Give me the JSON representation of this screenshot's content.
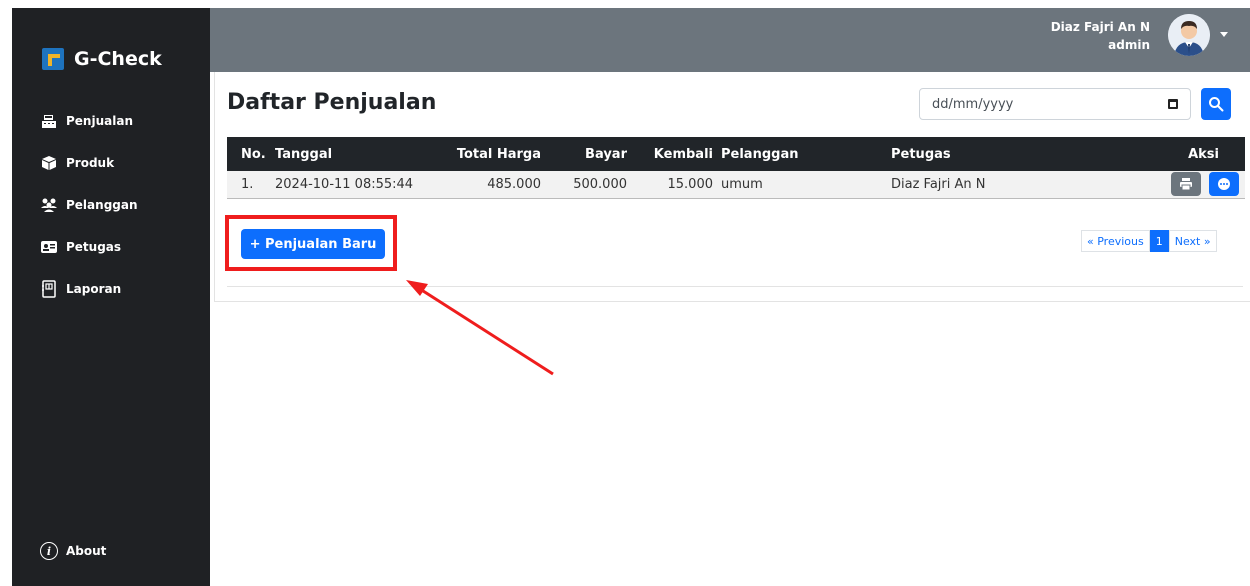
{
  "brand": {
    "name": "G-Check"
  },
  "sidebar": {
    "items": [
      {
        "label": "Penjualan",
        "icon": "cash-register-icon"
      },
      {
        "label": "Produk",
        "icon": "box-icon"
      },
      {
        "label": "Pelanggan",
        "icon": "users-icon"
      },
      {
        "label": "Petugas",
        "icon": "id-card-icon"
      },
      {
        "label": "Laporan",
        "icon": "book-icon"
      }
    ],
    "about_label": "About"
  },
  "topbar": {
    "user_name": "Diaz Fajri An N",
    "user_role": "admin"
  },
  "page": {
    "title": "Daftar Penjualan",
    "date_placeholder": "dd/mm/yyyy"
  },
  "table": {
    "headers": [
      "No.",
      "Tanggal",
      "Total Harga",
      "Bayar",
      "Kembali",
      "Pelanggan",
      "Petugas",
      "Aksi"
    ],
    "rows": [
      {
        "no": "1.",
        "tanggal": "2024-10-11 08:55:44",
        "total": "485.000",
        "bayar": "500.000",
        "kembali": "15.000",
        "pelanggan": "umum",
        "petugas": "Diaz Fajri An N"
      }
    ]
  },
  "actions": {
    "new_sale_label": "+ Penjualan Baru"
  },
  "pagination": {
    "prev": "« Previous",
    "current": "1",
    "next": "Next »"
  },
  "colors": {
    "primary": "#0d6efd",
    "sidebar": "#1f2124",
    "topbar": "#6c757d",
    "highlight": "#ef1d1d"
  }
}
